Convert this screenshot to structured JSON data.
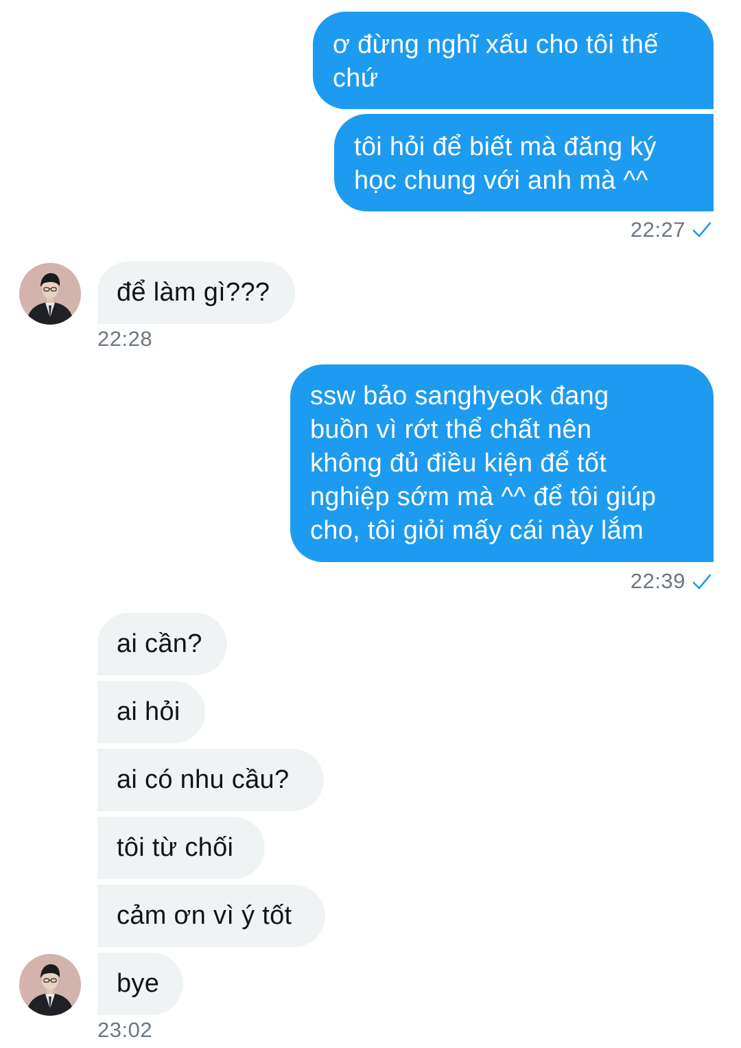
{
  "chat": {
    "messages": [
      {
        "sender": "me",
        "text": "ơ đừng nghĩ xấu cho tôi thế\nchứ"
      },
      {
        "sender": "me",
        "text": "tôi hỏi để biết mà đăng ký\nhọc chung với anh mà ^^"
      },
      {
        "sender": "them",
        "text": "để làm gì???"
      },
      {
        "sender": "me",
        "text": "ssw bảo sanghyeok đang\nbuồn vì rớt thể chất nên\nkhông đủ điều kiện để tốt\nnghiệp sớm mà ^^ để tôi giúp\ncho, tôi giỏi mấy cái này lắm"
      },
      {
        "sender": "them",
        "text": "ai cần?"
      },
      {
        "sender": "them",
        "text": "ai hỏi"
      },
      {
        "sender": "them",
        "text": "ai có nhu cầu?"
      },
      {
        "sender": "them",
        "text": "tôi từ chối"
      },
      {
        "sender": "them",
        "text": "cảm ơn vì ý tốt"
      },
      {
        "sender": "them",
        "text": "bye"
      }
    ],
    "timestamps": {
      "sent_1": "22:27",
      "received_1": "22:28",
      "sent_2": "22:39",
      "received_2": "23:02"
    },
    "read_icon": "checkmark-icon",
    "avatar_icon": "user-avatar-icon"
  },
  "colors": {
    "sent_bubble": "#1d9bf0",
    "received_bubble": "#eff3f4",
    "timestamp_text": "#6b7680",
    "checkmark": "#1d9bf0"
  }
}
